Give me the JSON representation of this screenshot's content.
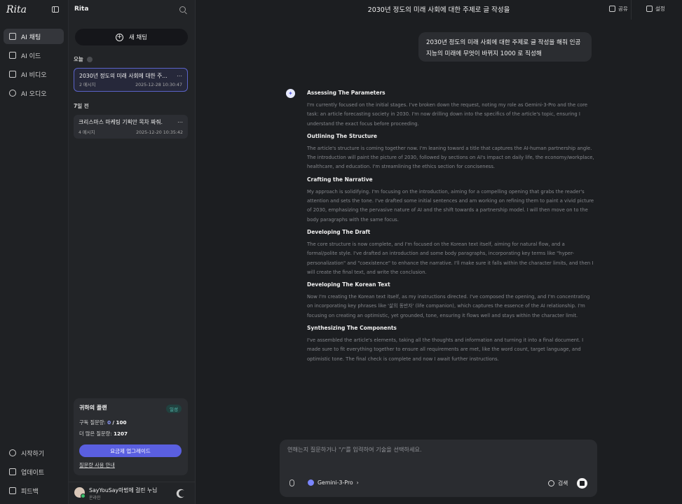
{
  "app": {
    "logo": "Rita"
  },
  "nav": {
    "items": [
      {
        "label": "AI 채팅",
        "icon": "chat-icon"
      },
      {
        "label": "AI 이드",
        "icon": "image-icon"
      },
      {
        "label": "AI 비디오",
        "icon": "video-icon"
      },
      {
        "label": "AI 오디오",
        "icon": "music-icon"
      }
    ],
    "bottom": [
      {
        "label": "시작하기",
        "icon": "help-icon"
      },
      {
        "label": "업데이트",
        "icon": "update-icon"
      },
      {
        "label": "피드백",
        "icon": "mail-icon"
      }
    ]
  },
  "conversations": {
    "title": "Rita",
    "new_chat": "새 채팅",
    "groups": [
      {
        "label": "오늘",
        "items": [
          {
            "title": "2030년 정도의 미래 사회에 대한 주...",
            "meta": "2 메시지",
            "date": "2025-12-28 10:30:47"
          }
        ]
      },
      {
        "label": "7일 전",
        "items": [
          {
            "title": "크리스마스 마케팅 기획안 목차 짜줘.",
            "meta": "4 메시지",
            "date": "2025-12-20 10:35:42"
          }
        ]
      }
    ]
  },
  "plan": {
    "title": "귀하의 플랜",
    "badge": "일성",
    "usage_label": "구독 질문량:",
    "usage_used": "0",
    "usage_total": "/ 100",
    "extra_label": "더 많은 질문량:",
    "extra_value": "1207",
    "upgrade": "요금제 업그레이드",
    "link": "질문량 사용 안내"
  },
  "user": {
    "name": "SayYouSay마법에 걸린 누님",
    "status": "온라인"
  },
  "header": {
    "title": "2030년 정도의 미래 사회에 대한 주제로 글 작성을",
    "share": "공유",
    "settings": "설정"
  },
  "chat": {
    "user_message": "2030년 정도의 미래 사회에 대한 주제로 글 작성을 해줘 인공지능의 미래에 무엇이 바뀌지 1000 로 직성해",
    "thoughts": [
      {
        "heading": "Assessing The Parameters",
        "body": "I'm currently focused on the initial stages. I've broken down the request, noting my role as Gemini-3-Pro and the core task: an article forecasting society in 2030. I'm now drilling down into the specifics of the article's topic, ensuring I understand the exact focus before proceeding."
      },
      {
        "heading": "Outlining The Structure",
        "body": "The article's structure is coming together now. I'm leaning toward a title that captures the AI-human partnership angle. The introduction will paint the picture of 2030, followed by sections on AI's impact on daily life, the economy/workplace, healthcare, and education. I'm streamlining the ethics section for conciseness."
      },
      {
        "heading": "Crafting the Narrative",
        "body": "My approach is solidifying. I'm focusing on the introduction, aiming for a compelling opening that grabs the reader's attention and sets the tone. I've drafted some initial sentences and am working on refining them to paint a vivid picture of 2030, emphasizing the pervasive nature of AI and the shift towards a partnership model. I will then move on to the body paragraphs with the same focus."
      },
      {
        "heading": "Developing The Draft",
        "body": "The core structure is now complete, and I'm focused on the Korean text itself, aiming for natural flow, and a formal/polite style. I've drafted an introduction and some body paragraphs, incorporating key terms like \"hyper-personalization\" and \"coexistence\" to enhance the narrative. I'll make sure it falls within the character limits, and then I will create the final text, and write the conclusion."
      },
      {
        "heading": "Developing The Korean Text",
        "body": "Now I'm creating the Korean text itself, as my instructions directed. I've composed the opening, and I'm concentrating on incorporating key phrases like '삶의 동반자' (life companion), which captures the essence of the AI relationship. I'm focusing on creating an optimistic, yet grounded, tone, ensuring it flows well and stays within the character limit."
      },
      {
        "heading": "Synthesizing The Components",
        "body": "I've assembled the article's elements, taking all the thoughts and information and turning it into a final document. I made sure to fit everything together to ensure all requirements are met, like the word count, target language, and optimistic tone. The final check is complete and now I await further instructions."
      }
    ]
  },
  "composer": {
    "placeholder": "연해는지 질문하거나 \"/\"를 입력하여 기술을 선택하세요.",
    "model": "Gemini-3-Pro",
    "web": "검색"
  }
}
